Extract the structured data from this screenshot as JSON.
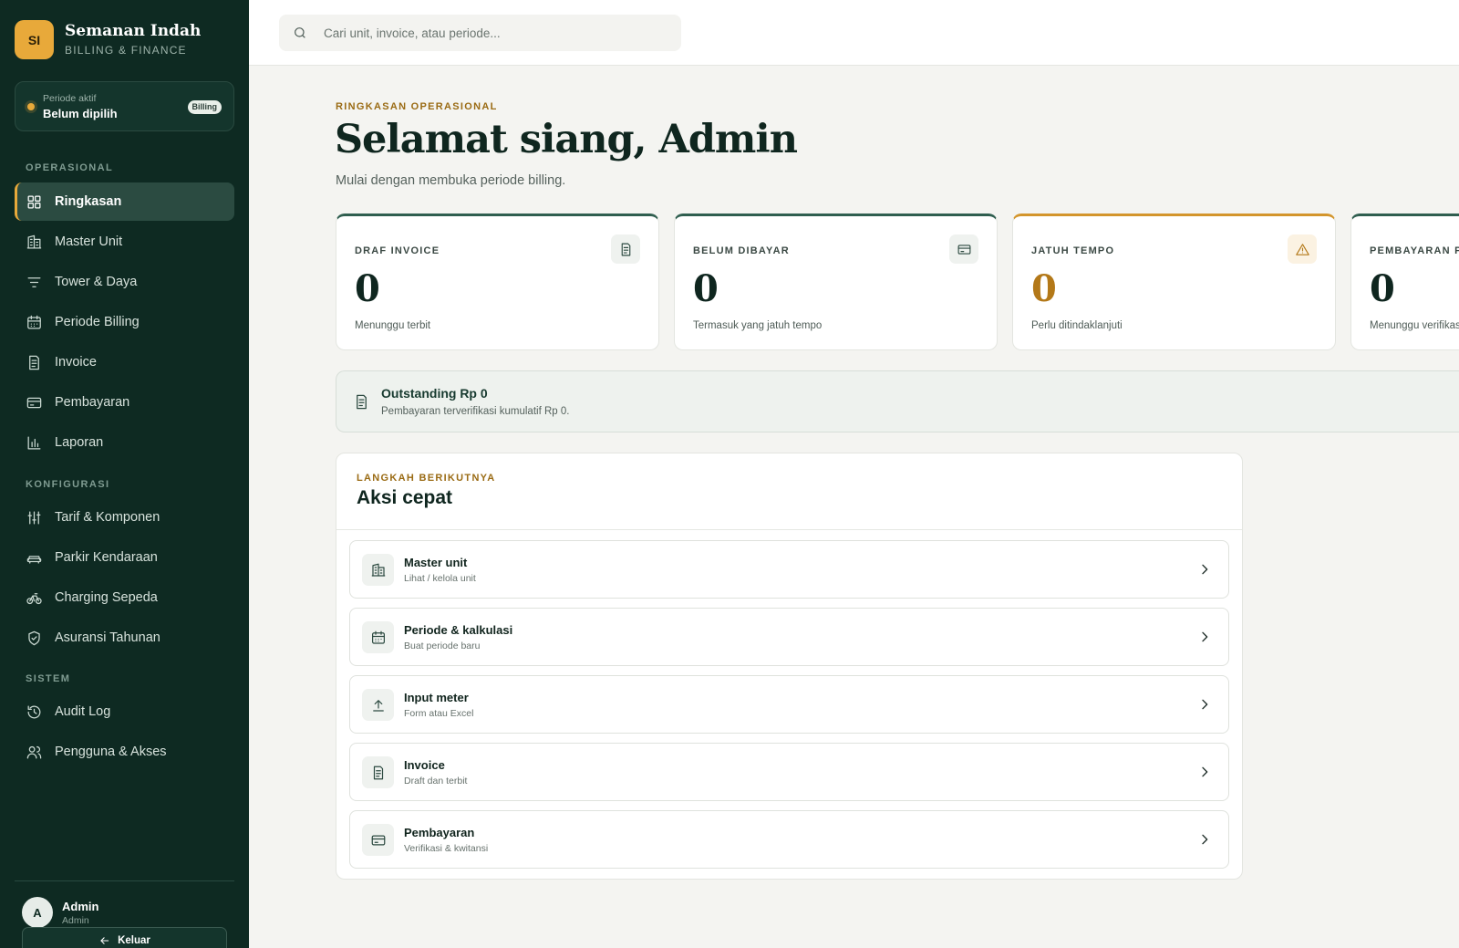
{
  "brand": {
    "initials": "SI",
    "name": "Semanan Indah",
    "subtitle": "BILLING & FINANCE"
  },
  "period": {
    "label": "Periode aktif",
    "value": "Belum dipilih",
    "badge": "Billing"
  },
  "sidebar": {
    "sections": [
      {
        "title": "OPERASIONAL",
        "items": [
          {
            "label": "Ringkasan",
            "icon": "grid-icon",
            "active": true
          },
          {
            "label": "Master Unit",
            "icon": "building-icon"
          },
          {
            "label": "Tower & Daya",
            "icon": "filter-lines-icon"
          },
          {
            "label": "Periode Billing",
            "icon": "calendar-icon"
          },
          {
            "label": "Invoice",
            "icon": "receipt-icon"
          },
          {
            "label": "Pembayaran",
            "icon": "credit-card-icon"
          },
          {
            "label": "Laporan",
            "icon": "bar-chart-icon"
          }
        ]
      },
      {
        "title": "KONFIGURASI",
        "items": [
          {
            "label": "Tarif & Komponen",
            "icon": "sliders-icon"
          },
          {
            "label": "Parkir Kendaraan",
            "icon": "car-icon"
          },
          {
            "label": "Charging Sepeda",
            "icon": "bicycle-icon"
          },
          {
            "label": "Asuransi Tahunan",
            "icon": "shield-icon"
          }
        ]
      },
      {
        "title": "SISTEM",
        "items": [
          {
            "label": "Audit Log",
            "icon": "history-icon"
          },
          {
            "label": "Pengguna & Akses",
            "icon": "users-icon"
          }
        ]
      }
    ]
  },
  "user": {
    "initial": "A",
    "name": "Admin",
    "role": "Admin",
    "logout_label": "Keluar"
  },
  "search": {
    "placeholder": "Cari unit, invoice, atau periode..."
  },
  "header": {
    "eyebrow": "RINGKASAN OPERASIONAL",
    "title": "Selamat siang, Admin",
    "subtitle": "Mulai dengan membuka periode billing."
  },
  "stats": [
    {
      "label": "DRAF INVOICE",
      "value": "0",
      "desc": "Menunggu terbit",
      "icon": "receipt-icon",
      "accent": "#2f5e4f"
    },
    {
      "label": "BELUM DIBAYAR",
      "value": "0",
      "desc": "Termasuk yang jatuh tempo",
      "icon": "credit-card-icon",
      "accent": "#2f5e4f"
    },
    {
      "label": "JATUH TEMPO",
      "value": "0",
      "desc": "Perlu ditindaklanjuti",
      "icon": "warning-icon",
      "accent": "#d3952c"
    },
    {
      "label": "PEMBAYARAN PENDING",
      "value": "0",
      "desc": "Menunggu verifikasi",
      "icon": "clock-icon",
      "accent": "#2f5e4f"
    }
  ],
  "outstanding": {
    "title": "Outstanding Rp 0",
    "subtitle": "Pembayaran terverifikasi kumulatif Rp 0."
  },
  "quick_actions": {
    "eyebrow": "LANGKAH BERIKUTNYA",
    "title": "Aksi cepat",
    "items": [
      {
        "title": "Master unit",
        "subtitle": "Lihat / kelola unit",
        "icon": "building-icon"
      },
      {
        "title": "Periode & kalkulasi",
        "subtitle": "Buat periode baru",
        "icon": "calendar-icon"
      },
      {
        "title": "Input meter",
        "subtitle": "Form atau Excel",
        "icon": "upload-icon"
      },
      {
        "title": "Invoice",
        "subtitle": "Draft dan terbit",
        "icon": "receipt-icon"
      },
      {
        "title": "Pembayaran",
        "subtitle": "Verifikasi & kwitansi",
        "icon": "credit-card-icon"
      }
    ]
  },
  "colors": {
    "sidebar_bg": "#0e2a22",
    "accent": "#e8a93a",
    "warning": "#b37818",
    "primary": "#2f5e4f"
  }
}
